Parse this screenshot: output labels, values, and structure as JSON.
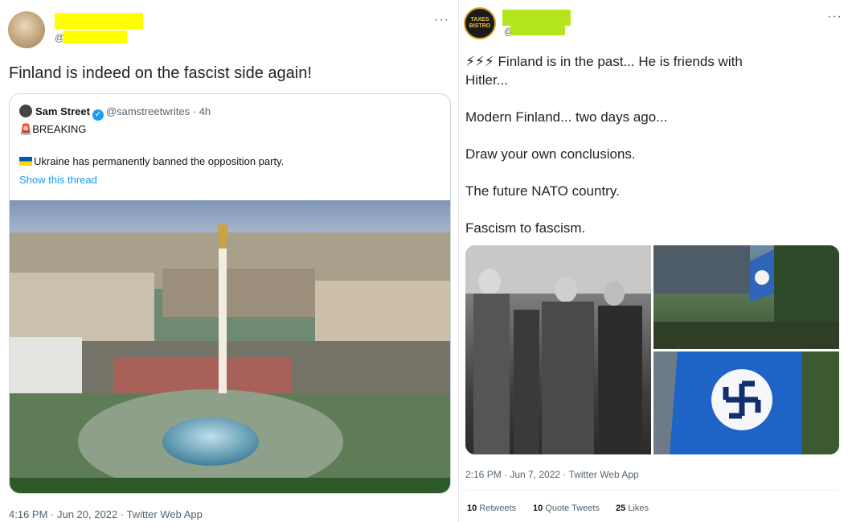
{
  "left_tweet": {
    "handle_prefix": "@",
    "text": "Finland is indeed on the fascist side again!",
    "more_icon": "···",
    "quote": {
      "author_name": "Sam Street",
      "author_handle": "@samstreetwrites",
      "time": "4h",
      "breaking_icon": "🚨",
      "breaking": "BREAKING",
      "flag_icon": "flag-ukraine-icon",
      "text": "Ukraine has permanently banned the opposition party.",
      "thread_link": "Show this thread",
      "image": "Kyiv Maidan square aerial view"
    },
    "timestamp": "4:16 PM · Jun 20, 2022 · Twitter Web App"
  },
  "right_tweet": {
    "handle_prefix": "@",
    "more_icon": "···",
    "lines": [
      "⚡⚡⚡ Finland is in the past... He is friends with",
      "Hitler...",
      "Modern Finland... two days ago...",
      "Draw your own conclusions.",
      "The future NATO country.",
      "Fascism to fascism."
    ],
    "avatar_text": "TAXES BISTRO",
    "timestamp": "2:16 PM · Jun 7, 2022 · Twitter Web App",
    "stats": {
      "retweets_count": "10",
      "retweets_label": "Retweets",
      "quotes_count": "10",
      "quotes_label": "Quote Tweets",
      "likes_count": "25",
      "likes_label": "Likes"
    }
  },
  "colors": {
    "redaction_left": "#ffff00",
    "redaction_right": "#b5e61d",
    "link": "#1d9bf0",
    "muted": "#536471"
  }
}
